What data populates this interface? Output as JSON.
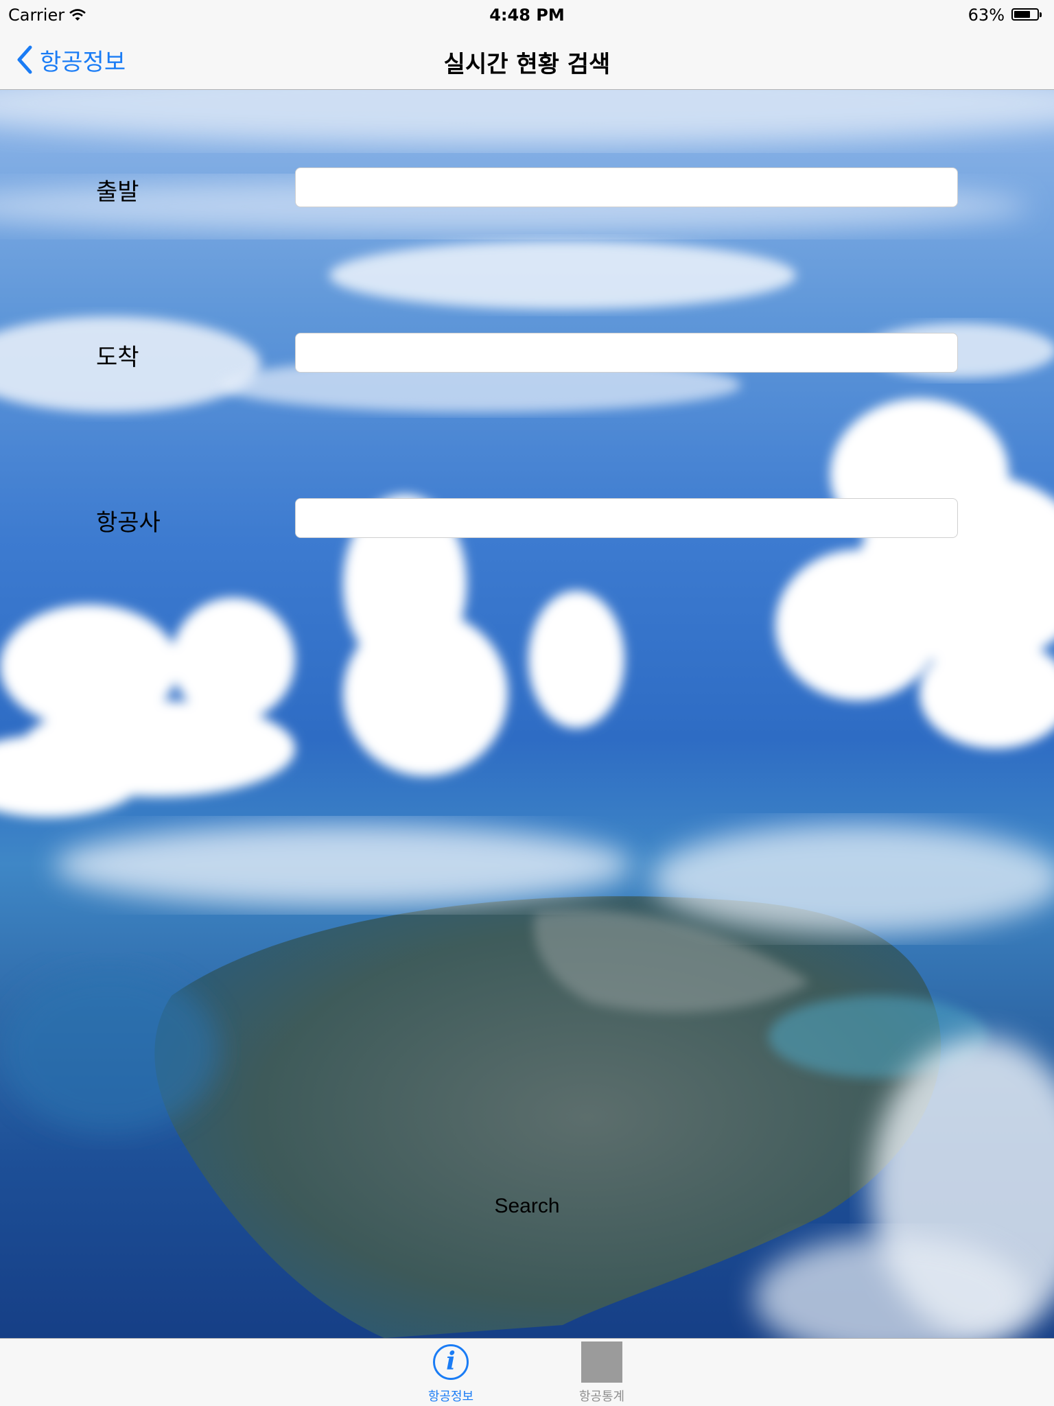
{
  "status_bar": {
    "carrier": "Carrier",
    "time": "4:48 PM",
    "battery": "63%"
  },
  "nav_bar": {
    "back_label": "항공정보",
    "title": "실시간 현황 검색"
  },
  "form": {
    "departure": {
      "label": "출발",
      "value": "",
      "placeholder": ""
    },
    "arrival": {
      "label": "도착",
      "value": "",
      "placeholder": ""
    },
    "airline": {
      "label": "항공사",
      "value": "",
      "placeholder": ""
    },
    "search_label": "Search"
  },
  "tab_bar": {
    "tabs": [
      {
        "label": "항공정보",
        "icon": "info-icon",
        "selected": true
      },
      {
        "label": "항공통계",
        "icon": "placeholder-square-icon",
        "selected": false
      }
    ]
  },
  "colors": {
    "accent": "#1a7cf5",
    "bar_background": "#f7f7f7",
    "inactive_tab": "#8e8e8e"
  }
}
